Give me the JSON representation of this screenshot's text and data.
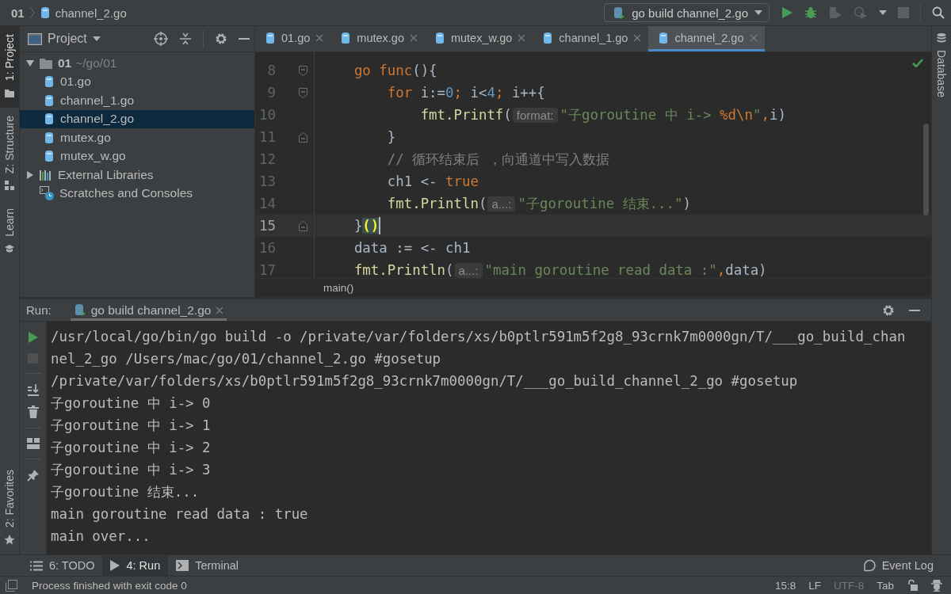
{
  "navbar": {
    "breadcrumb": [
      {
        "label": "01",
        "kind": "folder"
      },
      {
        "label": "channel_2.go",
        "kind": "file"
      }
    ],
    "run_config": "go build channel_2.go"
  },
  "left_tool_windows": [
    {
      "label": "1: Project",
      "kind": "project",
      "selected": true
    },
    {
      "label": "Z: Structure",
      "kind": "structure",
      "selected": false
    },
    {
      "label": "Learn",
      "kind": "learn",
      "selected": false
    }
  ],
  "left_tool_windows_bottom": [
    {
      "label": "2: Favorites",
      "kind": "favorites",
      "selected": false
    }
  ],
  "right_tool_windows": [
    {
      "label": "Database",
      "kind": "database",
      "selected": false
    }
  ],
  "project": {
    "title": "Project",
    "tree": [
      {
        "label": "01",
        "detail": "~/go/01",
        "kind": "folder",
        "expanded": true,
        "selected": false,
        "children": [
          {
            "label": "01.go",
            "kind": "file",
            "selected": false
          },
          {
            "label": "channel_1.go",
            "kind": "file",
            "selected": false
          },
          {
            "label": "channel_2.go",
            "kind": "file",
            "selected": true
          },
          {
            "label": "mutex.go",
            "kind": "file",
            "selected": false
          },
          {
            "label": "mutex_w.go",
            "kind": "file",
            "selected": false
          }
        ]
      },
      {
        "label": "External Libraries",
        "kind": "libraries",
        "expanded": false,
        "selected": false
      },
      {
        "label": "Scratches and Consoles",
        "kind": "scratches",
        "selected": false
      }
    ]
  },
  "editor": {
    "tabs": [
      {
        "label": "01.go",
        "selected": false
      },
      {
        "label": "mutex.go",
        "selected": false
      },
      {
        "label": "mutex_w.go",
        "selected": false
      },
      {
        "label": "channel_1.go",
        "selected": false
      },
      {
        "label": "channel_2.go",
        "selected": true
      }
    ],
    "lines": [
      {
        "number": "8",
        "fold_start": true,
        "fold_end": false,
        "current": false,
        "segments": [
          {
            "kind": "keyword",
            "t": "    go func"
          },
          {
            "kind": "plain",
            "t": "(){"
          }
        ]
      },
      {
        "number": "9",
        "fold_start": true,
        "fold_end": false,
        "current": false,
        "segments": [
          {
            "kind": "keyword",
            "t": "        for"
          },
          {
            "kind": "plain",
            "t": " i:="
          },
          {
            "kind": "number",
            "t": "0"
          },
          {
            "kind": "keyword",
            "t": ";"
          },
          {
            "kind": "plain",
            "t": " i<"
          },
          {
            "kind": "number",
            "t": "4"
          },
          {
            "kind": "keyword",
            "t": ";"
          },
          {
            "kind": "plain",
            "t": " i++{"
          }
        ]
      },
      {
        "number": "10",
        "fold_start": false,
        "fold_end": false,
        "current": false,
        "segments": [
          {
            "kind": "func",
            "t": "            fmt.Printf"
          },
          {
            "kind": "plain",
            "t": "("
          },
          {
            "kind": "hint",
            "t": "format:"
          },
          {
            "kind": "string",
            "t": "\"子goroutine 中 i-> "
          },
          {
            "kind": "escape",
            "t": "%d\\n"
          },
          {
            "kind": "string",
            "t": "\""
          },
          {
            "kind": "keyword",
            "t": ","
          },
          {
            "kind": "plain",
            "t": "i)"
          }
        ]
      },
      {
        "number": "11",
        "fold_start": false,
        "fold_end": true,
        "current": false,
        "segments": [
          {
            "kind": "plain",
            "t": "        }"
          }
        ]
      },
      {
        "number": "12",
        "fold_start": false,
        "fold_end": false,
        "current": false,
        "segments": [
          {
            "kind": "comment",
            "t": "        // 循环结束后 ，向通道中写入数据"
          }
        ]
      },
      {
        "number": "13",
        "fold_start": false,
        "fold_end": false,
        "current": false,
        "segments": [
          {
            "kind": "plain",
            "t": "        ch1 <- "
          },
          {
            "kind": "keyword",
            "t": "true"
          }
        ]
      },
      {
        "number": "14",
        "fold_start": false,
        "fold_end": false,
        "current": false,
        "segments": [
          {
            "kind": "func",
            "t": "        fmt.Println"
          },
          {
            "kind": "plain",
            "t": "("
          },
          {
            "kind": "hint",
            "t": "a...:"
          },
          {
            "kind": "string",
            "t": "\"子goroutine 结束...\""
          },
          {
            "kind": "plain",
            "t": ")"
          }
        ]
      },
      {
        "number": "15",
        "fold_start": false,
        "fold_end": true,
        "current": true,
        "segments": [
          {
            "kind": "plain",
            "t": "    }"
          },
          {
            "kind": "match",
            "t": "()"
          }
        ]
      },
      {
        "number": "16",
        "fold_start": false,
        "fold_end": false,
        "current": false,
        "segments": [
          {
            "kind": "plain",
            "t": "    data := <- ch1"
          }
        ]
      },
      {
        "number": "17",
        "fold_start": false,
        "fold_end": false,
        "current": false,
        "segments": [
          {
            "kind": "func",
            "t": "    fmt.Println"
          },
          {
            "kind": "plain",
            "t": "("
          },
          {
            "kind": "hint",
            "t": "a...:"
          },
          {
            "kind": "string",
            "t": "\"main goroutine read data :\""
          },
          {
            "kind": "keyword",
            "t": ","
          },
          {
            "kind": "plain",
            "t": "data)"
          }
        ]
      }
    ],
    "breadcrumb": "main()"
  },
  "run": {
    "label": "Run:",
    "tab": "go build channel_2.go",
    "output": [
      "/usr/local/go/bin/go build -o /private/var/folders/xs/b0ptlr591m5f2g8_93crnk7m0000gn/T/___go_build_chan",
      "nel_2_go /Users/mac/go/01/channel_2.go #gosetup",
      "/private/var/folders/xs/b0ptlr591m5f2g8_93crnk7m0000gn/T/___go_build_channel_2_go #gosetup",
      "子goroutine 中 i-> 0",
      "子goroutine 中 i-> 1",
      "子goroutine 中 i-> 2",
      "子goroutine 中 i-> 3",
      "子goroutine 结束...",
      "main goroutine read data : true",
      "main over..."
    ]
  },
  "bottom_tabs": [
    {
      "label": "6: TODO",
      "kind": "todo",
      "selected": false
    },
    {
      "label": "4: Run",
      "kind": "run",
      "selected": true
    },
    {
      "label": "Terminal",
      "kind": "terminal",
      "selected": false
    }
  ],
  "event_log": "Event Log",
  "status": {
    "message": "Process finished with exit code 0",
    "fields": [
      {
        "label": "15:8",
        "disabled": false
      },
      {
        "label": "LF",
        "disabled": false
      },
      {
        "label": "UTF-8",
        "disabled": true
      },
      {
        "label": "Tab",
        "disabled": false
      }
    ]
  }
}
